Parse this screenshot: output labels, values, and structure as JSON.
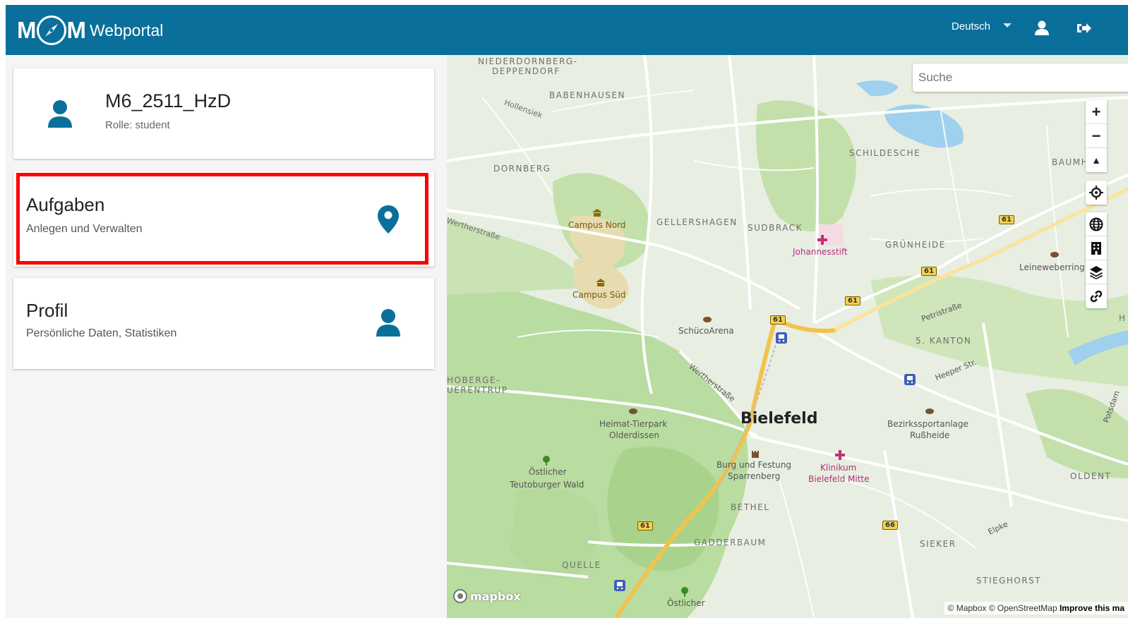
{
  "header": {
    "logo_left": "M",
    "logo_right": "M",
    "brand": "Webportal",
    "language": "Deutsch",
    "accent_color": "#0a6f9b"
  },
  "user_card": {
    "name": "M6_2511_HzD",
    "role": "Rolle: student",
    "icon": "user-icon"
  },
  "menu": {
    "aufgaben": {
      "title": "Aufgaben",
      "subtitle": "Anlegen und Verwalten",
      "icon": "map-marker-icon"
    },
    "profil": {
      "title": "Profil",
      "subtitle": "Persönliche Daten, Statistiken",
      "icon": "user-icon"
    }
  },
  "map": {
    "search_placeholder": "Suche",
    "controls": {
      "zoom_in": "+",
      "zoom_out": "−",
      "compass": "▲"
    },
    "attribution_text": "© Mapbox © OpenStreetMap",
    "attribution_link": "Improve this ma",
    "mapbox_logo": "mapbox",
    "labels": {
      "niederdornberg": "NIEDERDORNBERG-",
      "deppendorf": "DEPPENDORF",
      "babenhausen": "BABENHAUSEN",
      "hollensiek": "Hollensiek",
      "dornberg": "DORNBERG",
      "schildesche": "SCHILDESCHE",
      "baumh": "BAUMH",
      "wertherstrasse1": "Wertherstraße",
      "campus_nord": "Campus Nord",
      "gellershagen": "GELLERSHAGEN",
      "sudbrack": "SUDBRACK",
      "johannesstift": "Johannesstift",
      "gruenheide": "GRÜNHEIDE",
      "leineweberring": "Leineweberring",
      "campus_sued": "Campus Süd",
      "schuecoarena": "SchücoArena",
      "petristrasse": "Petristraße",
      "kanton": "5. KANTON",
      "heeper": "Heeper Str.",
      "hoberge1": "HOBERGE-",
      "hoberge2": "UERENTRUP",
      "wertherstrasse2": "Wertherstraße",
      "bielefeld": "Bielefeld",
      "heimat": "Heimat-Tierpark",
      "olderdissen": "Olderdissen",
      "bezirk": "Bezirkssportanlage",
      "russheide": "Rußheide",
      "potsdam": "Potsdam",
      "burg": "Burg und Festung",
      "sparrenberg": "Sparrenberg",
      "klinikum": "Klinikum",
      "bielefeld_mitte": "Bielefeld Mitte",
      "oestlicher": "Östlicher",
      "teutoburger": "Teutoburger Wald",
      "oldent": "OLDENT",
      "bethel": "BETHEL",
      "gadderbaum": "GADDERBAUM",
      "sieker": "SIEKER",
      "elpke": "Elpke",
      "quelle": "QUELLE",
      "stieghorst": "STIEGHORST",
      "oestlicher2": "Östlicher",
      "h_edge": "H",
      "shield61": "61",
      "shield66": "66"
    }
  }
}
